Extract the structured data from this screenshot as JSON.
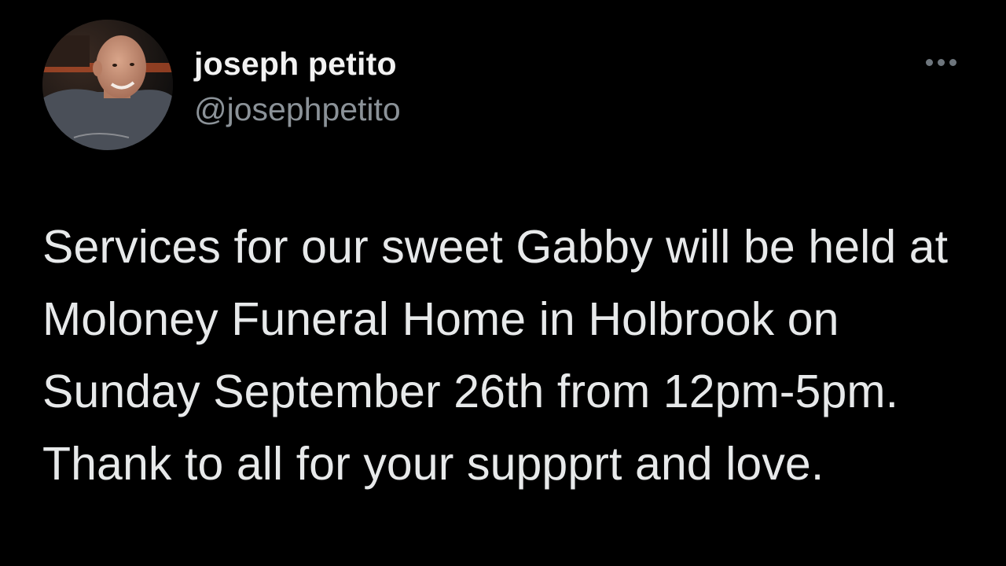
{
  "tweet": {
    "author": {
      "display_name": "joseph petito",
      "handle": "@josephpetito"
    },
    "text": "Services for our sweet Gabby will be held at Moloney Funeral Home in Holbrook on Sunday September 26th from 12pm-5pm.  Thank to all for your suppprt and love."
  },
  "icons": {
    "more": "more-options-icon",
    "avatar": "profile-avatar"
  },
  "colors": {
    "background": "#000000",
    "name": "#f2f2f2",
    "handle": "#8b9298",
    "body": "#e7e9ea",
    "more_dots": "#6e767d"
  }
}
